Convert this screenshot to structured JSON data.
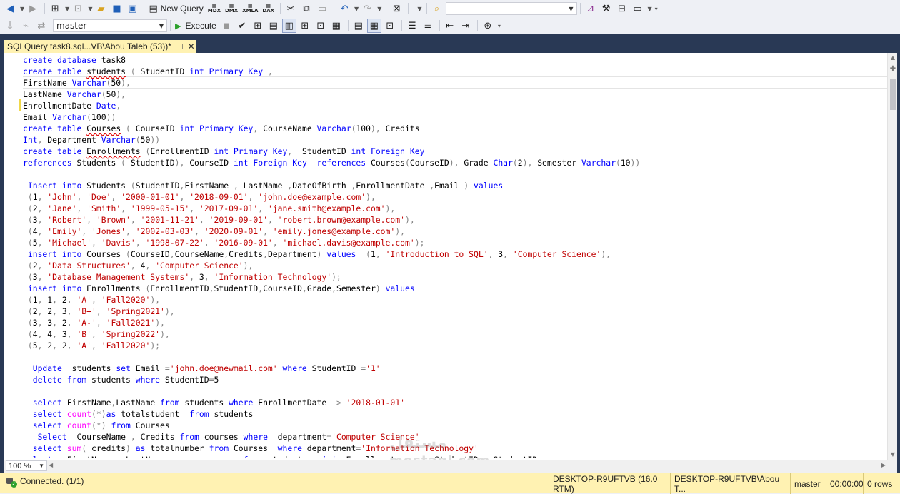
{
  "toolbar1": {
    "new_query_label": "New Query",
    "icon_labels": [
      "MDX",
      "DMX",
      "XMLA",
      "DAX"
    ],
    "search_value": ""
  },
  "toolbar2": {
    "database_value": "master",
    "execute_label": "Execute"
  },
  "tab": {
    "title": "SQLQuery task8.sql...VB\\Abou Taleb (53))*",
    "pin": "⊣",
    "close": "✕"
  },
  "editor": {
    "lines": [
      "create database task8",
      "create table students ( StudentID int Primary Key ,",
      "FirstName Varchar(50),",
      "LastName Varchar(50),",
      "EnrollmentDate Date,",
      "Email Varchar(100))",
      "create table Courses ( CourseID int Primary Key, CourseName Varchar(100), Credits",
      "Int, Department Varchar(50))",
      "create table Enrollments (EnrollmentID int Primary Key,  StudentID int Foreign Key",
      "references Students ( StudentID), CourseID int Foreign Key  references Courses(CourseID), Grade Char(2), Semester Varchar(10))",
      "",
      " Insert into Students (StudentID,FirstName , LastName ,DateOfBirth ,EnrollmentDate ,Email ) values",
      " (1, 'John', 'Doe', '2000-01-01', '2018-09-01', 'john.doe@example.com'),",
      " (2, 'Jane', 'Smith', '1999-05-15', '2017-09-01', 'jane.smith@example.com'),",
      " (3, 'Robert', 'Brown', '2001-11-21', '2019-09-01', 'robert.brown@example.com'),",
      " (4, 'Emily', 'Jones', '2002-03-03', '2020-09-01', 'emily.jones@example.com'),",
      " (5, 'Michael', 'Davis', '1998-07-22', '2016-09-01', 'michael.davis@example.com');",
      " insert into Courses (CourseID,CourseName,Credits,Department) values  (1, 'Introduction to SQL', 3, 'Computer Science'),",
      " (2, 'Data Structures', 4, 'Computer Science'),",
      " (3, 'Database Management Systems', 3, 'Information Technology');",
      " insert into Enrollments (EnrollmentID,StudentID,CourseID,Grade,Semester) values",
      " (1, 1, 2, 'A', 'Fall2020'),",
      " (2, 2, 3, 'B+', 'Spring2021'),",
      " (3, 3, 2, 'A-', 'Fall2021'),",
      " (4, 4, 3, 'B', 'Spring2022'),",
      " (5, 2, 2, 'A', 'Fall2020');",
      "",
      "  Update  students set Email ='john.doe@newmail.com' where StudentID ='1'",
      "  delete from students where StudentID=5",
      "",
      "  select FirstName,LastName from students where EnrollmentDate  > '2018-01-01'",
      "  select count(*)as totalstudent  from students",
      "  select count(*) from Courses",
      "   Select  CourseName , Credits from courses where  department='Computer Science'",
      "  select sum( credits) as totalnumber from Courses  where department='Information Technology'",
      "select s.FirstName,s.LastName , c.coursename from students s join Enrollment e on s.StudentID=e.StudentID"
    ]
  },
  "zoom": {
    "value": "100 %"
  },
  "status": {
    "connection": "Connected. (1/1)",
    "server": "DESKTOP-R9UFTVB (16.0 RTM)",
    "login": "DESKTOP-R9UFTVB\\Abou T...",
    "database": "master",
    "elapsed": "00:00:00",
    "rows": "0 rows"
  },
  "watermark": {
    "brand": "mostaql.com"
  },
  "colors": {
    "keyword": "#0000ff",
    "string": "#c00000",
    "function": "#ff00ff",
    "tab_active": "#fff2b2",
    "frame": "#293955",
    "statusbar": "#fff2b2"
  }
}
